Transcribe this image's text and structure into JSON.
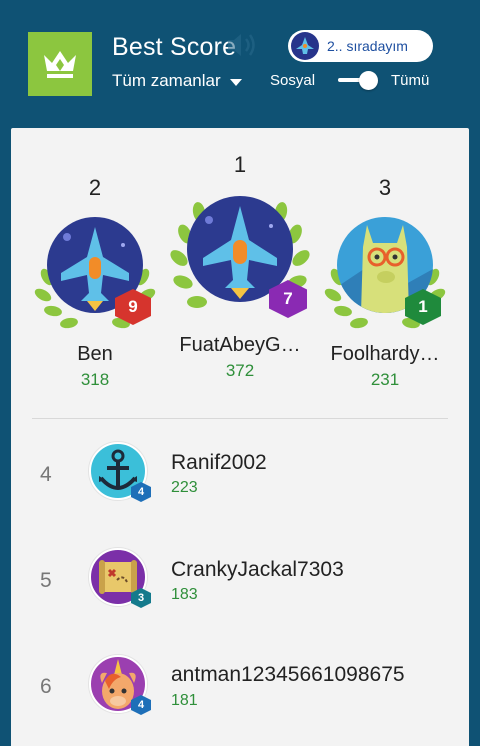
{
  "header": {
    "title": "Best Score",
    "rank_pill": "2.. sıradayım",
    "period": "Tüm zamanlar",
    "social_label": "Sosyal",
    "all_label": "Tümü",
    "toggle_on": true,
    "accent": "#8cc63f"
  },
  "podium": [
    {
      "rank": "2",
      "name": "Ben",
      "score": "318",
      "level": "9",
      "badge_color": "#d6342d"
    },
    {
      "rank": "1",
      "name": "FuatAbeyG…",
      "score": "372",
      "level": "7",
      "badge_color": "#8a2ab3"
    },
    {
      "rank": "3",
      "name": "Foolhardy…",
      "score": "231",
      "level": "1",
      "badge_color": "#1f8a3c"
    }
  ],
  "list": [
    {
      "rank": "4",
      "name": "Ranif2002",
      "score": "223",
      "level": "4",
      "avatar": "anchor-icon"
    },
    {
      "rank": "5",
      "name": "CrankyJackal7303",
      "score": "183",
      "level": "3",
      "avatar": "treasure-map-icon"
    },
    {
      "rank": "6",
      "name": "antman12345661098675",
      "score": "181",
      "level": "4",
      "avatar": "unicorn-icon"
    }
  ]
}
